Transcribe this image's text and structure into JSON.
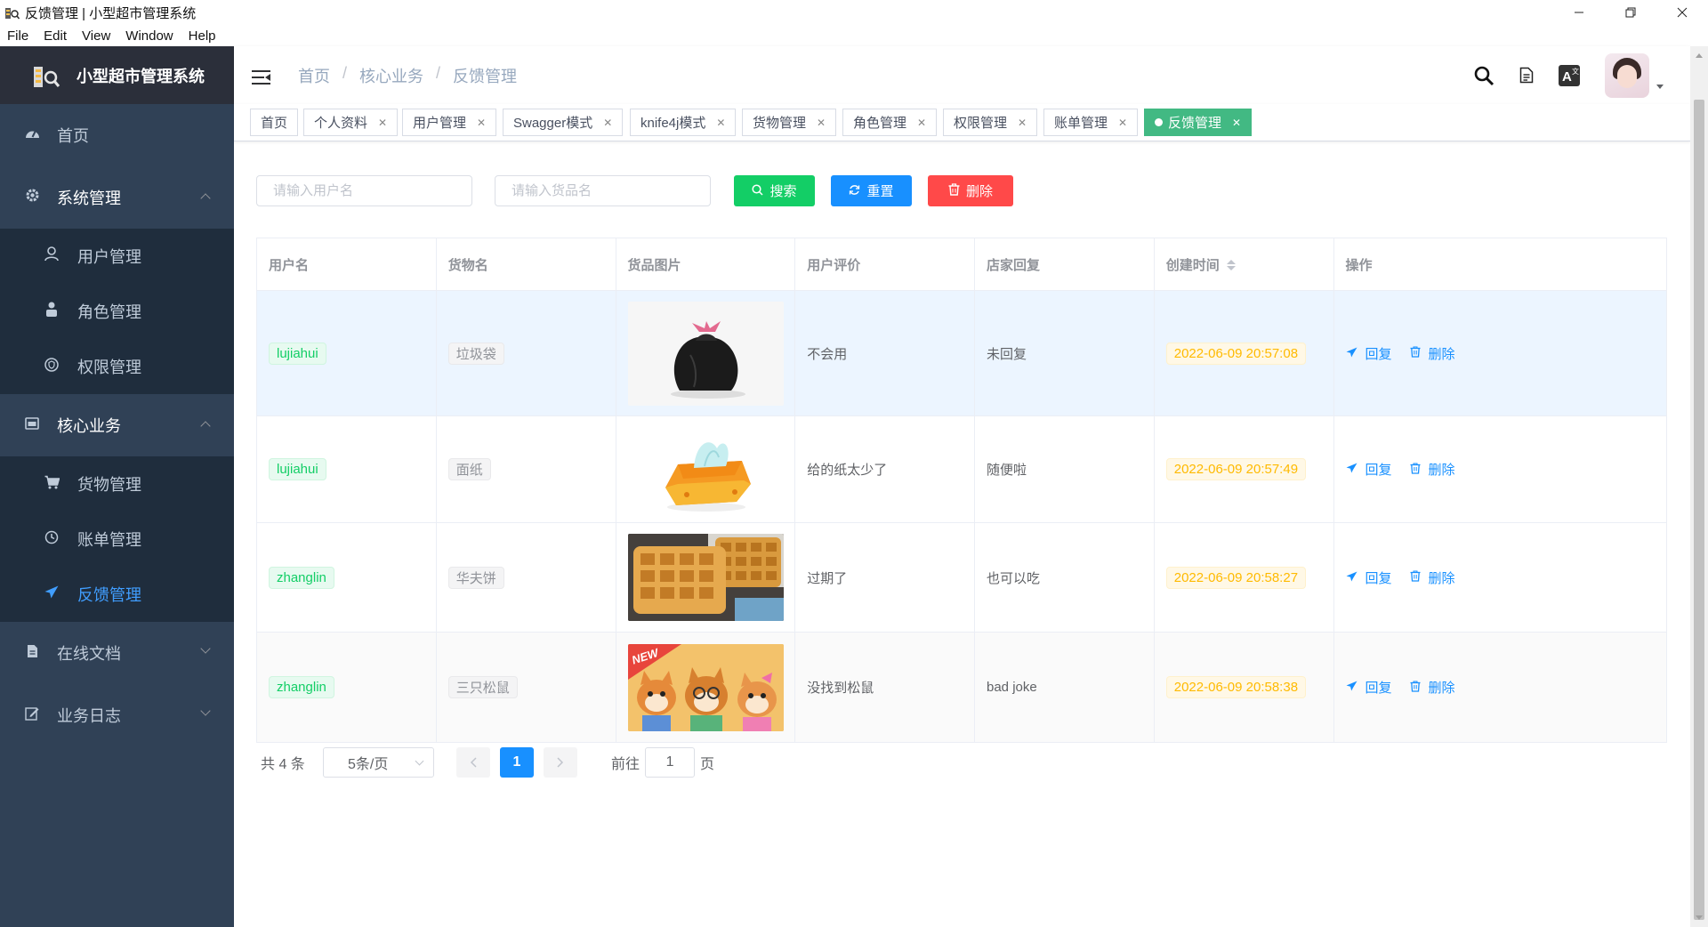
{
  "window": {
    "title": "反馈管理 | 小型超市管理系统",
    "menu": [
      "File",
      "Edit",
      "View",
      "Window",
      "Help"
    ]
  },
  "sidebar": {
    "logo_title": "小型超市管理系统",
    "items": [
      {
        "label": "首页",
        "icon": "dashboard-icon"
      },
      {
        "label": "系统管理",
        "icon": "gear-icon",
        "children": [
          {
            "label": "用户管理",
            "icon": "user-icon"
          },
          {
            "label": "角色管理",
            "icon": "people-icon"
          },
          {
            "label": "权限管理",
            "icon": "shield-icon"
          }
        ]
      },
      {
        "label": "核心业务",
        "icon": "monitor-icon",
        "children": [
          {
            "label": "货物管理",
            "icon": "cart-icon"
          },
          {
            "label": "账单管理",
            "icon": "clock-icon"
          },
          {
            "label": "反馈管理",
            "icon": "send-icon"
          }
        ]
      },
      {
        "label": "在线文档",
        "icon": "document-icon"
      },
      {
        "label": "业务日志",
        "icon": "edit-icon"
      }
    ]
  },
  "navbar": {
    "breadcrumb": [
      "首页",
      "核心业务",
      "反馈管理"
    ],
    "icons": [
      "search-icon",
      "document-icon",
      "translate-icon"
    ]
  },
  "tags": [
    "首页",
    "个人资料",
    "用户管理",
    "Swagger模式",
    "knife4j模式",
    "货物管理",
    "角色管理",
    "权限管理",
    "账单管理",
    "反馈管理"
  ],
  "filters": {
    "username_placeholder": "请输入用户名",
    "goods_placeholder": "请输入货品名",
    "search_label": "搜索",
    "reset_label": "重置",
    "delete_label": "删除"
  },
  "table": {
    "headers": [
      "用户名",
      "货物名",
      "货品图片",
      "用户评价",
      "店家回复",
      "创建时间",
      "操作"
    ],
    "rows": [
      {
        "user": "lujiahui",
        "goods": "垃圾袋",
        "image": "garbage-bag",
        "comment": "不会用",
        "reply": "未回复",
        "time": "2022-06-09 20:57:08"
      },
      {
        "user": "lujiahui",
        "goods": "面纸",
        "image": "tissue-box",
        "comment": "给的纸太少了",
        "reply": "随便啦",
        "time": "2022-06-09 20:57:49"
      },
      {
        "user": "zhanglin",
        "goods": "华夫饼",
        "image": "waffles",
        "comment": "过期了",
        "reply": "也可以吃",
        "time": "2022-06-09 20:58:27"
      },
      {
        "user": "zhanglin",
        "goods": "三只松鼠",
        "image": "three-squirrels",
        "comment": "没找到松鼠",
        "reply": "bad joke",
        "time": "2022-06-09 20:58:38"
      }
    ],
    "op_reply": "回复",
    "op_delete": "删除"
  },
  "pagination": {
    "total": "共 4 条",
    "page_size": "5条/页",
    "current": "1",
    "goto_prefix": "前往",
    "goto_value": "1",
    "goto_suffix": "页"
  },
  "colors": {
    "sidebar_bg": "#304156",
    "active_menu": "#409eff",
    "active_tag": "#42b983",
    "primary": "#1890ff"
  }
}
